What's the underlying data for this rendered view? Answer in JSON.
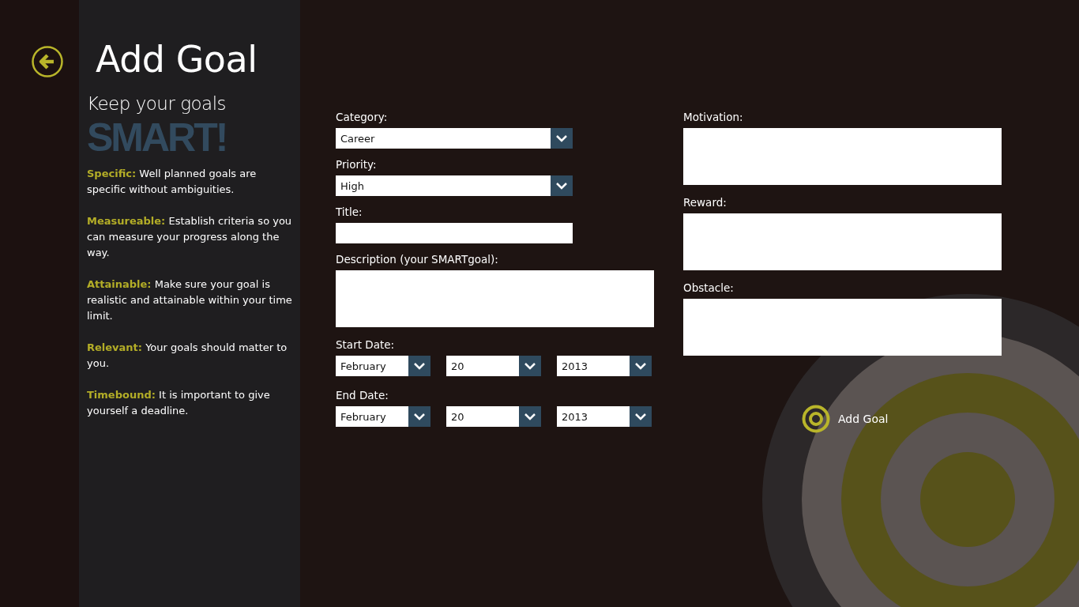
{
  "header": {
    "title": "Add Goal"
  },
  "sidebar": {
    "heading": "Keep your goals",
    "slogan": "SMART!",
    "tips": [
      {
        "text": "**Specific:** Well planned goals are specific without ambiguities."
      },
      {
        "text": "**Measureable:** Establish criteria so you can measure your progress along the way."
      },
      {
        "text": "**Attainable:** Make sure your goal is realistic and attainable within your time limit."
      },
      {
        "text": "**Relevant:** Your goals should matter to you."
      },
      {
        "text": "**Timebound:** It is important to give yourself a deadline."
      }
    ]
  },
  "form": {
    "left_column": [
      {
        "kind": "select",
        "label": "Category:",
        "value": "Career"
      },
      {
        "kind": "select",
        "label": "Priority:",
        "value": "High"
      },
      {
        "kind": "text",
        "label": "Title:"
      },
      {
        "kind": "textarea",
        "label": "Description (your SMARTgoal):"
      },
      {
        "kind": "date",
        "label": "Start Date:",
        "parts": [
          {
            "value": "February"
          },
          {
            "value": "20"
          },
          {
            "value": "2013"
          }
        ]
      },
      {
        "kind": "date",
        "label": "End Date:",
        "parts": [
          {
            "value": "February"
          },
          {
            "value": "20"
          },
          {
            "value": "2013"
          }
        ]
      }
    ],
    "right_column": [
      {
        "kind": "textarea",
        "label": "Motivation:"
      },
      {
        "kind": "textarea",
        "label": "Reward:"
      },
      {
        "kind": "textarea",
        "label": "Obstacle:"
      }
    ],
    "submit": {
      "label": "Add Goal"
    }
  }
}
